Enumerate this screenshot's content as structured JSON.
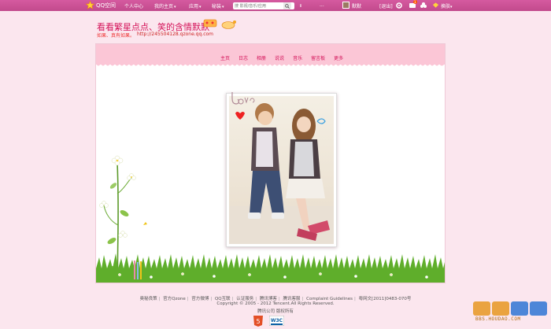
{
  "topbar": {
    "brand": "QQ空间",
    "personal_center": "个人中心",
    "my_home": "我的主页",
    "apps": "应用",
    "games": "秘装",
    "search_placeholder": "搜 影视/音乐/应用",
    "dots": "...",
    "user_name": "默默",
    "logout": "[退出]",
    "notif_count": "1",
    "vip": "换肤"
  },
  "header": {
    "title": "看看繁星点点、笑的含情默默",
    "subtitle": "如果、真有如果。",
    "url": "http://245504128.qzone.qq.com"
  },
  "menu": {
    "items": [
      "主页",
      "日志",
      "相册",
      "说说",
      "音乐",
      "留言板",
      "更多"
    ]
  },
  "footer": {
    "links": [
      "奥秘良策",
      "官方Qzone",
      "官方微博",
      "QQ互联",
      "认证服务",
      "腾讯博客",
      "腾讯客服",
      "Complaint Guidelines",
      "粤网文[2011]0483-070号"
    ],
    "copyright": "Copyright © 2005 - 2012 Tencent.All Rights Reserved.",
    "owner": "腾讯公司 版权所有",
    "w3c_label": "W3C",
    "html5_label": "5"
  },
  "watermark": {
    "domain": "BBS.HOUDAO.COM"
  },
  "colors": {
    "topbar": "#c94e93",
    "background": "#fbe6ee",
    "title": "#d4145a",
    "menu_strip": "#fbc6d6"
  }
}
